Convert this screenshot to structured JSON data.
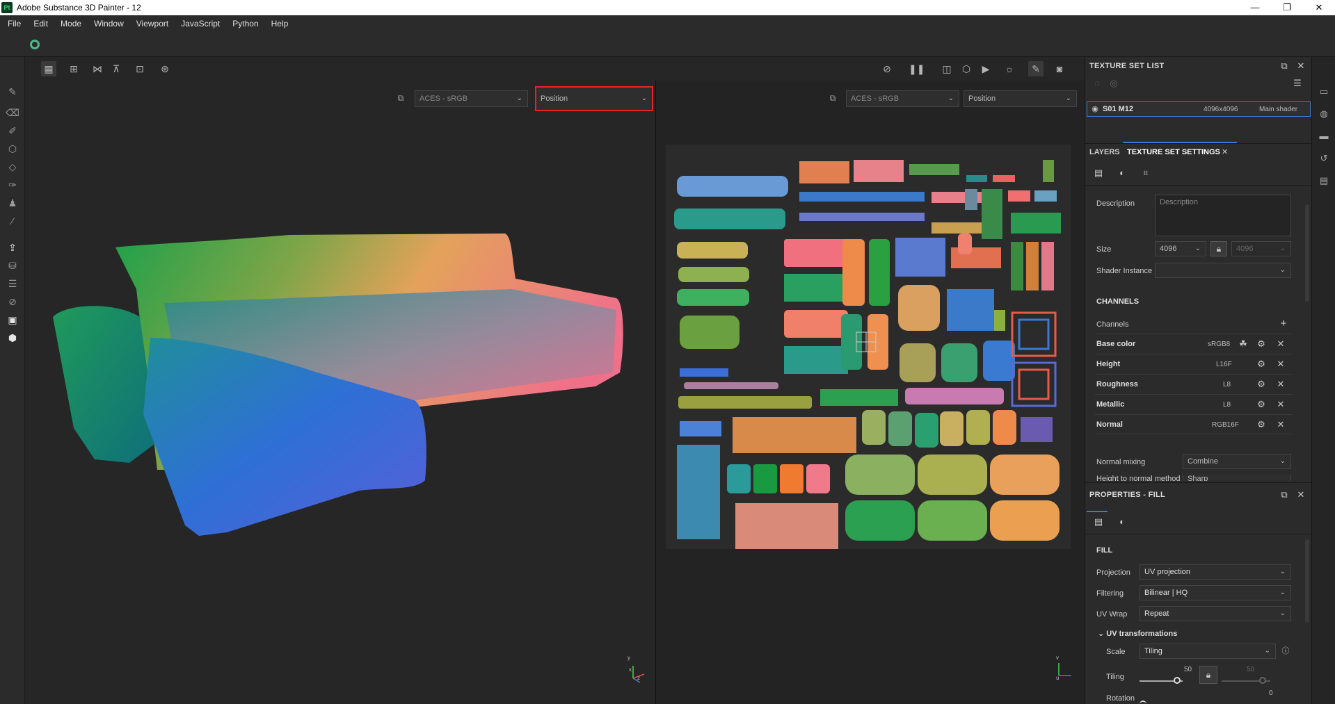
{
  "window": {
    "app_icon": "Pt",
    "title": "Adobe Substance 3D Painter - 12",
    "controls": {
      "minimize": "—",
      "restore": "❐",
      "close": "✕"
    }
  },
  "menu": [
    "File",
    "Edit",
    "Mode",
    "Window",
    "Viewport",
    "JavaScript",
    "Python",
    "Help"
  ],
  "viewport3d": {
    "colorspace": "ACES - sRGB",
    "display_channel": "Position"
  },
  "viewport2d": {
    "colorspace": "ACES - sRGB",
    "display_channel": "Position"
  },
  "axis_labels": {
    "x": "x",
    "y": "y",
    "z": "z",
    "u": "u",
    "v": "v"
  },
  "texture_set_list": {
    "title": "TEXTURE SET LIST",
    "item": {
      "name": "S01 M12",
      "size": "4096x4096",
      "shader": "Main shader"
    }
  },
  "tabs": {
    "layers": "LAYERS",
    "texture_set_settings": "TEXTURE SET SETTINGS",
    "close": "✕"
  },
  "texture_set_settings": {
    "description_label": "Description",
    "description_placeholder": "Description",
    "size_label": "Size",
    "size_value": "4096",
    "size_value_locked": "4096",
    "shader_instance_label": "Shader Instance",
    "shader_instance_value": "",
    "channels_header": "CHANNELS",
    "channels_label": "Channels",
    "channels": [
      {
        "name": "Base color",
        "format": "sRGB8"
      },
      {
        "name": "Height",
        "format": "L16F"
      },
      {
        "name": "Roughness",
        "format": "L8"
      },
      {
        "name": "Metallic",
        "format": "L8"
      },
      {
        "name": "Normal",
        "format": "RGB16F"
      }
    ],
    "normal_mixing_label": "Normal mixing",
    "normal_mixing_value": "Combine",
    "height_to_normal_label": "Height to normal method",
    "height_to_normal_value": "Sharp"
  },
  "properties_fill": {
    "title": "PROPERTIES - FILL",
    "section": "FILL",
    "projection_label": "Projection",
    "projection_value": "UV projection",
    "filtering_label": "Filtering",
    "filtering_value": "Bilinear | HQ",
    "uvwrap_label": "UV Wrap",
    "uvwrap_value": "Repeat",
    "uv_transformations": "UV transformations",
    "scale_label": "Scale",
    "scale_value": "Tiling",
    "tiling_label": "Tiling",
    "tiling_value": "50",
    "tiling_value_locked": "50",
    "tiling_fraction": 0.4,
    "rotation_label": "Rotation",
    "rotation_value": "0"
  }
}
